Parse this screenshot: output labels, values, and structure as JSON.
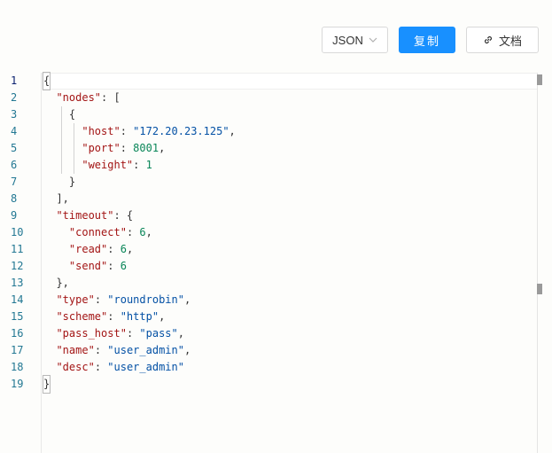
{
  "toolbar": {
    "language_label": "JSON",
    "language_icon": "chevron-down-icon",
    "copy_label": "复制",
    "doc_label": "文档",
    "doc_icon": "link-icon",
    "accent_color": "#1890ff"
  },
  "editor": {
    "line_numbers": [
      "1",
      "2",
      "3",
      "4",
      "5",
      "6",
      "7",
      "8",
      "9",
      "10",
      "11",
      "12",
      "13",
      "14",
      "15",
      "16",
      "17",
      "18",
      "19"
    ],
    "lines": [
      [
        [
          "p",
          "{"
        ]
      ],
      [
        [
          "p",
          "  "
        ],
        [
          "k",
          "\"nodes\""
        ],
        [
          "p",
          ": ["
        ]
      ],
      [
        [
          "p",
          "    {"
        ]
      ],
      [
        [
          "p",
          "      "
        ],
        [
          "k",
          "\"host\""
        ],
        [
          "p",
          ": "
        ],
        [
          "s",
          "\"172.20.23.125\""
        ],
        [
          "p",
          ","
        ]
      ],
      [
        [
          "p",
          "      "
        ],
        [
          "k",
          "\"port\""
        ],
        [
          "p",
          ": "
        ],
        [
          "n",
          "8001"
        ],
        [
          "p",
          ","
        ]
      ],
      [
        [
          "p",
          "      "
        ],
        [
          "k",
          "\"weight\""
        ],
        [
          "p",
          ": "
        ],
        [
          "n",
          "1"
        ]
      ],
      [
        [
          "p",
          "    }"
        ]
      ],
      [
        [
          "p",
          "  ],"
        ]
      ],
      [
        [
          "p",
          "  "
        ],
        [
          "k",
          "\"timeout\""
        ],
        [
          "p",
          ": {"
        ]
      ],
      [
        [
          "p",
          "    "
        ],
        [
          "k",
          "\"connect\""
        ],
        [
          "p",
          ": "
        ],
        [
          "n",
          "6"
        ],
        [
          "p",
          ","
        ]
      ],
      [
        [
          "p",
          "    "
        ],
        [
          "k",
          "\"read\""
        ],
        [
          "p",
          ": "
        ],
        [
          "n",
          "6"
        ],
        [
          "p",
          ","
        ]
      ],
      [
        [
          "p",
          "    "
        ],
        [
          "k",
          "\"send\""
        ],
        [
          "p",
          ": "
        ],
        [
          "n",
          "6"
        ]
      ],
      [
        [
          "p",
          "  },"
        ]
      ],
      [
        [
          "p",
          "  "
        ],
        [
          "k",
          "\"type\""
        ],
        [
          "p",
          ": "
        ],
        [
          "s",
          "\"roundrobin\""
        ],
        [
          "p",
          ","
        ]
      ],
      [
        [
          "p",
          "  "
        ],
        [
          "k",
          "\"scheme\""
        ],
        [
          "p",
          ": "
        ],
        [
          "s",
          "\"http\""
        ],
        [
          "p",
          ","
        ]
      ],
      [
        [
          "p",
          "  "
        ],
        [
          "k",
          "\"pass_host\""
        ],
        [
          "p",
          ": "
        ],
        [
          "s",
          "\"pass\""
        ],
        [
          "p",
          ","
        ]
      ],
      [
        [
          "p",
          "  "
        ],
        [
          "k",
          "\"name\""
        ],
        [
          "p",
          ": "
        ],
        [
          "s",
          "\"user_admin\""
        ],
        [
          "p",
          ","
        ]
      ],
      [
        [
          "p",
          "  "
        ],
        [
          "k",
          "\"desc\""
        ],
        [
          "p",
          ": "
        ],
        [
          "s",
          "\"user_admin\""
        ]
      ],
      [
        [
          "p",
          "}"
        ]
      ]
    ]
  }
}
